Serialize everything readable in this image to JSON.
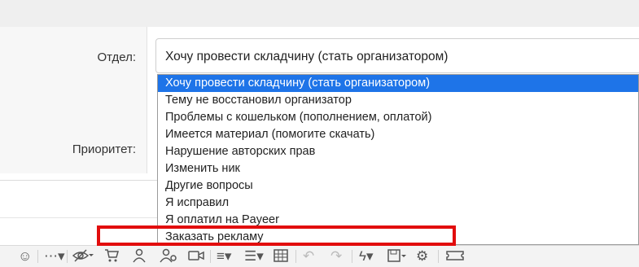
{
  "form": {
    "department_label": "Отдел:",
    "priority_label": "Приоритет:",
    "department_value": "Хочу провести складчину (стать организатором)"
  },
  "dropdown": {
    "options": [
      "Хочу провести складчину (стать организатором)",
      "Тему не восстановил организатор",
      "Проблемы с кошельком (пополнением, оплатой)",
      "Имеется материал (помогите скачать)",
      "Нарушение авторских прав",
      "Изменить ник",
      "Другие вопросы",
      "Я исправил",
      "Я оплатил на Payeer",
      "Заказать рекламу"
    ],
    "selected_index": 0
  },
  "annotation": {
    "highlight_color": "#e20d0d",
    "highlighted_option": "Заказать рекламу"
  },
  "colors": {
    "selected_bg": "#1e74e8"
  },
  "toolbar_icons": [
    "emoji-icon",
    "more-icon",
    "hide-icon",
    "cart-icon",
    "user-icon",
    "users-icon",
    "video-icon",
    "align-icon",
    "list-icon",
    "table-icon",
    "undo-icon",
    "redo-icon",
    "flash-icon",
    "save-icon",
    "gear-icon",
    "ticket-icon"
  ]
}
